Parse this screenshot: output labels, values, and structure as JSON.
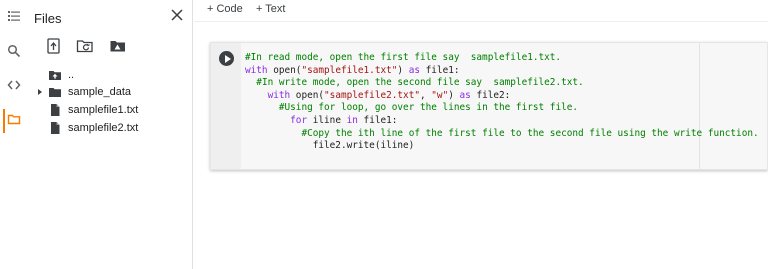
{
  "rail": {
    "items": [
      "menu",
      "search",
      "code",
      "files"
    ]
  },
  "files_panel": {
    "title": "Files",
    "tree": [
      {
        "label": "..",
        "type": "parent"
      },
      {
        "label": "sample_data",
        "type": "folder"
      },
      {
        "label": "samplefile1.txt",
        "type": "file"
      },
      {
        "label": "samplefile2.txt",
        "type": "file"
      }
    ]
  },
  "toolbar": {
    "add_code": "+ Code",
    "add_text": "+ Text"
  },
  "cell": {
    "lines": [
      {
        "indent": "",
        "parts": [
          {
            "t": "#In read mode, open the first file say  samplefile1.txt.",
            "c": "cm"
          }
        ]
      },
      {
        "indent": "",
        "parts": [
          {
            "t": "with",
            "c": "kw"
          },
          {
            "t": " open(",
            "c": "pl"
          },
          {
            "t": "\"samplefile1.txt\"",
            "c": "st"
          },
          {
            "t": ") ",
            "c": "pl"
          },
          {
            "t": "as",
            "c": "kw"
          },
          {
            "t": " file1:",
            "c": "pl"
          }
        ]
      },
      {
        "indent": "  ",
        "parts": [
          {
            "t": "#In write mode, open the second file say  samplefile2.txt.",
            "c": "cm"
          }
        ]
      },
      {
        "indent": "    ",
        "parts": [
          {
            "t": "with",
            "c": "kw"
          },
          {
            "t": " open(",
            "c": "pl"
          },
          {
            "t": "\"samplefile2.txt\"",
            "c": "st"
          },
          {
            "t": ", ",
            "c": "pl"
          },
          {
            "t": "\"w\"",
            "c": "st"
          },
          {
            "t": ") ",
            "c": "pl"
          },
          {
            "t": "as",
            "c": "kw"
          },
          {
            "t": " file2:",
            "c": "pl"
          }
        ]
      },
      {
        "indent": "      ",
        "parts": [
          {
            "t": "#Using for loop, go over the lines in the first file.",
            "c": "cm"
          }
        ]
      },
      {
        "indent": "        ",
        "parts": [
          {
            "t": "for",
            "c": "kw"
          },
          {
            "t": " iline ",
            "c": "pl"
          },
          {
            "t": "in",
            "c": "kw"
          },
          {
            "t": " file1:",
            "c": "pl"
          }
        ]
      },
      {
        "indent": "          ",
        "parts": [
          {
            "t": "#Copy the ith line of the first file to the second file using the write function.",
            "c": "cm"
          }
        ]
      },
      {
        "indent": "            ",
        "parts": [
          {
            "t": "file2.write(iline)",
            "c": "pl"
          }
        ]
      }
    ]
  },
  "colors": {
    "accent": "#f57c00",
    "comment": "#008000",
    "keyword": "#8a2be2",
    "string": "#a31515"
  }
}
